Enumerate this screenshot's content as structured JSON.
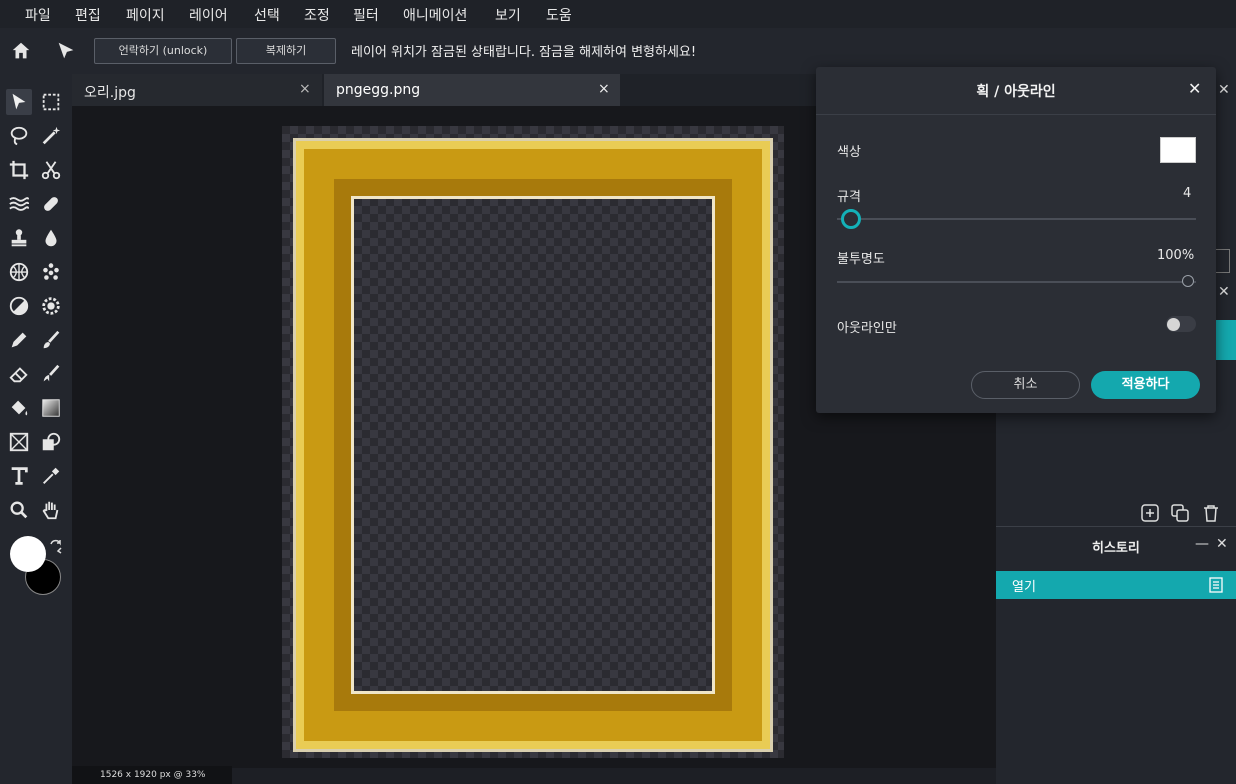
{
  "menu": [
    "파일",
    "편집",
    "페이지",
    "레이어",
    "선택",
    "조정",
    "필터",
    "애니메이션",
    "보기",
    "도움"
  ],
  "options_bar": {
    "unlock_label": "언락하기 (unlock)",
    "duplicate_label": "복제하기",
    "lock_message": "레이어 위치가 잠금된 상태랍니다. 잠금을 해제하여 변형하세요!"
  },
  "tabs": [
    {
      "label": "오리.jpg",
      "close": "×"
    },
    {
      "label": "pngegg.png",
      "close": "×"
    }
  ],
  "status": "1526 x 1920 px @ 33%",
  "dialog": {
    "title": "획 / 아웃라인",
    "close": "✕",
    "color_label": "색상",
    "color_value": "#ffffff",
    "size_label": "규격",
    "size_value": "4",
    "opacity_label": "불투명도",
    "opacity_value": "100%",
    "outline_only_label": "아웃라인만",
    "cancel_label": "취소",
    "apply_label": "적용하다"
  },
  "history": {
    "title": "히스토리",
    "items": [
      "열기"
    ]
  },
  "colors": {
    "accent": "#14a8ae",
    "foreground": "#ffffff",
    "background": "#000000"
  }
}
